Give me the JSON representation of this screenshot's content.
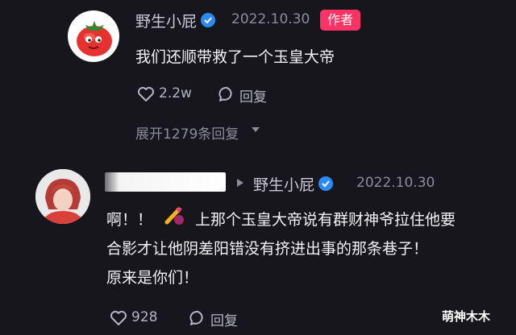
{
  "comment": {
    "avatar_icon": "tomato-avatar-icon",
    "username": "野生小屁",
    "date": "2022.10.30",
    "author_badge": "作者",
    "text": "我们还顺带救了一个玉皇大帝",
    "like_count": "2.2w",
    "reply_label": "回复",
    "expand_label": "展开1279条回复"
  },
  "reply": {
    "avatar_icon": "user-photo-avatar",
    "reply_to_username": "野生小屁",
    "date": "2022.10.30",
    "text_line1_before": "啊！！",
    "emoji_icon": "pick-and-bag-emoji",
    "text_line1_after": "上那个玉皇大帝说有群财神爷拉住他要",
    "text_line2": "合影才让他阴差阳错没有挤进出事的那条巷子！",
    "text_line3": "原来是你们！",
    "like_count": "928",
    "reply_label": "回复"
  },
  "watermark": "萌神木木",
  "colors": {
    "background": "#16161c",
    "verified_blue": "#2a8bf2",
    "author_badge": "#fb3264"
  }
}
